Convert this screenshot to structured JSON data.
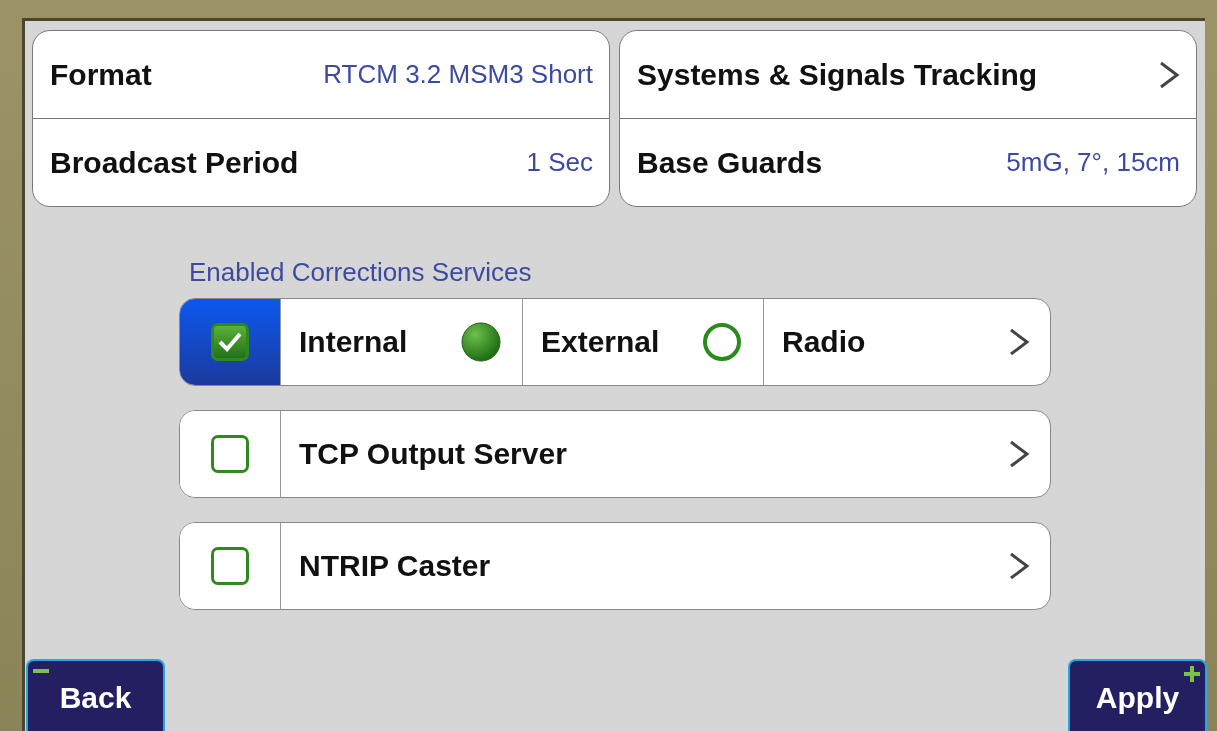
{
  "cards": [
    {
      "rows": [
        {
          "kind": "value",
          "label": "Format",
          "value": "RTCM 3.2 MSM3 Short"
        },
        {
          "kind": "value",
          "label": "Broadcast Period",
          "value": "1 Sec"
        }
      ]
    },
    {
      "rows": [
        {
          "kind": "link",
          "label": "Systems & Signals Tracking"
        },
        {
          "kind": "value",
          "label": "Base Guards",
          "value": "5mG, 7°, 15cm"
        }
      ]
    }
  ],
  "services": {
    "title": "Enabled Corrections Services",
    "items": [
      {
        "kind": "segmented",
        "checked": true,
        "segments": [
          {
            "kind": "indicator",
            "label": "Internal",
            "on": true
          },
          {
            "kind": "indicator",
            "label": "External",
            "on": false
          },
          {
            "kind": "link",
            "label": "Radio"
          }
        ]
      },
      {
        "kind": "single",
        "checked": false,
        "label": "TCP Output Server"
      },
      {
        "kind": "single",
        "checked": false,
        "label": "NTRIP Caster"
      }
    ]
  },
  "buttons": [
    {
      "kind": "minus",
      "label": "Back"
    },
    {
      "kind": "plus",
      "label": "Apply"
    }
  ]
}
